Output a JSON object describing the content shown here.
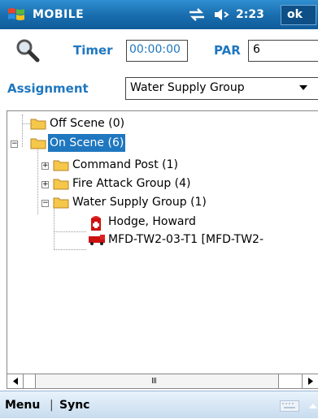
{
  "title_bar": {
    "app_title": "MOBILE",
    "clock": "2:23",
    "ok_label": "ok"
  },
  "form": {
    "timer_label": "Timer",
    "timer_value": "00:00:00",
    "par_label": "PAR",
    "par_value": "6",
    "assignment_label": "Assignment",
    "assignment_selected": "Water Supply Group"
  },
  "tree": {
    "off_scene": "Off Scene (0)",
    "on_scene": "On Scene (6)",
    "command_post": "Command Post (1)",
    "fire_attack": "Fire Attack Group (4)",
    "water_supply": "Water Supply Group (1)",
    "person": "Hodge, Howard",
    "apparatus": "MFD-TW2-03-T1 [MFD-TW2-"
  },
  "bottom_bar": {
    "menu_label": "Menu",
    "separator": "|",
    "sync_label": "Sync"
  },
  "colors": {
    "titlebar": "#1a6fb0",
    "label_blue": "#1f77bf",
    "selection": "#1f77bf"
  },
  "scrollbar": {
    "thumb_glyph": "Ⅲ"
  }
}
